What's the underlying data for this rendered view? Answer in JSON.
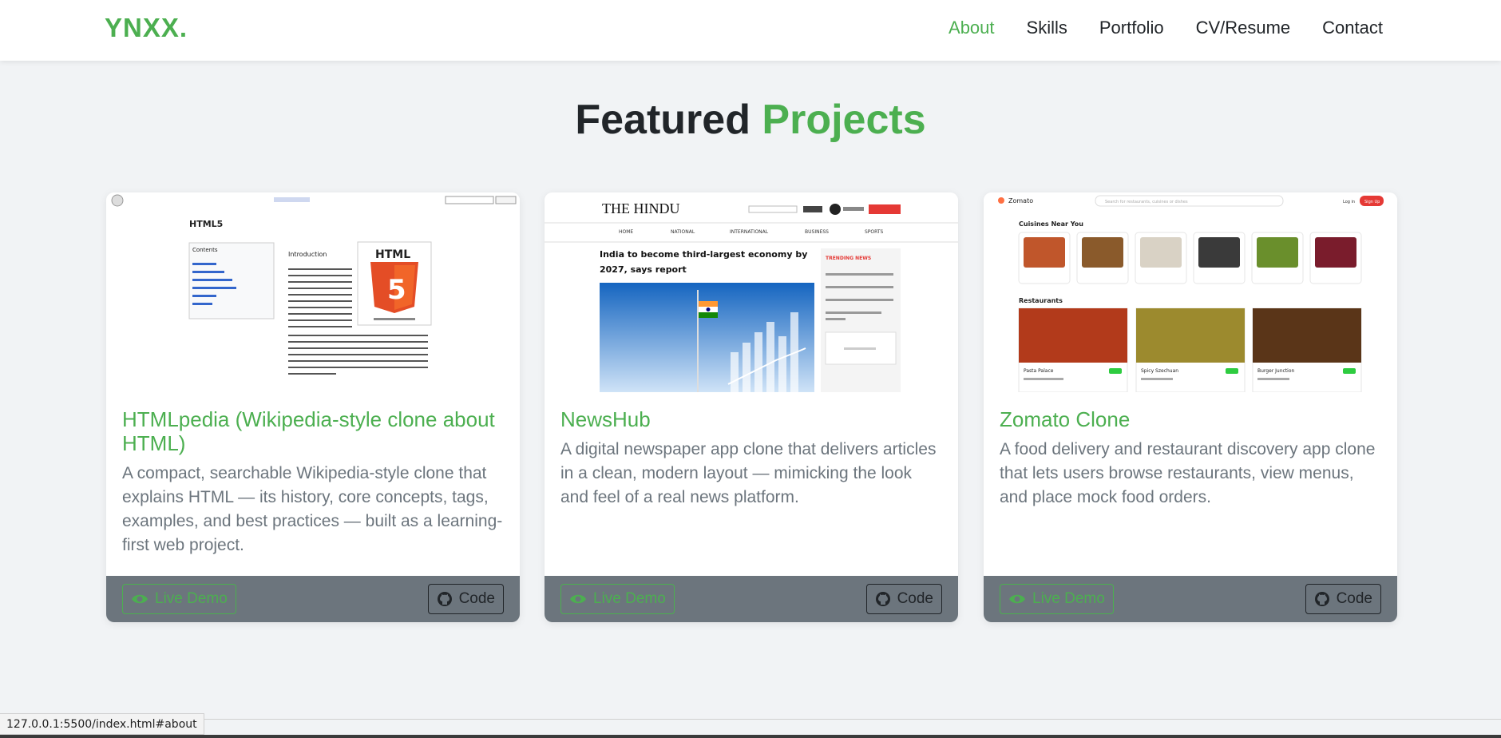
{
  "brand": "YNXX.",
  "nav": {
    "about": "About",
    "skills": "Skills",
    "portfolio": "Portfolio",
    "cv": "CV/Resume",
    "contact": "Contact"
  },
  "section": {
    "title_plain": "Featured",
    "title_accent": "Projects"
  },
  "projects": [
    {
      "title": "HTMLpedia (Wikipedia-style clone about HTML)",
      "description": "A compact, searchable Wikipedia-style clone that explains HTML — its history, core concepts, tags, examples, and best practices — built as a learning-first web project.",
      "demo_label": "Live Demo",
      "code_label": "Code",
      "thumb": {
        "heading": "HTML5",
        "contents": "Contents",
        "intro": "Introduction",
        "logo_text": "HTML",
        "logo_number": "5"
      }
    },
    {
      "title": "NewsHub",
      "description": "A digital newspaper app clone that delivers articles in a clean, modern layout — mimicking the look and feel of a real news platform.",
      "demo_label": "Live Demo",
      "code_label": "Code",
      "thumb": {
        "masthead": "THE HINDU",
        "headline": "India to become third-largest economy by 2027, says report",
        "trending": "TRENDING NEWS",
        "nav": [
          "HOME",
          "NATIONAL",
          "INTERNATIONAL",
          "BUSINESS",
          "SPORTS"
        ]
      }
    },
    {
      "title": "Zomato Clone",
      "description": "A food delivery and restaurant discovery app clone that lets users browse restaurants, view menus, and place mock food orders.",
      "demo_label": "Live Demo",
      "code_label": "Code",
      "thumb": {
        "logo": "Zomato",
        "search": "Search for restaurants, cuisines or dishes",
        "login": "Log in",
        "signup": "Sign Up",
        "cuisines_heading": "Cuisines Near You",
        "restaurants_heading": "Restaurants",
        "restaurants": [
          "Pasta Palace",
          "Spicy Szechuan",
          "Burger Junction"
        ]
      }
    }
  ],
  "status_url": "127.0.0.1:5500/index.html#about",
  "colors": {
    "accent": "#4caf50",
    "footer": "#6c757d",
    "text": "#212529"
  }
}
